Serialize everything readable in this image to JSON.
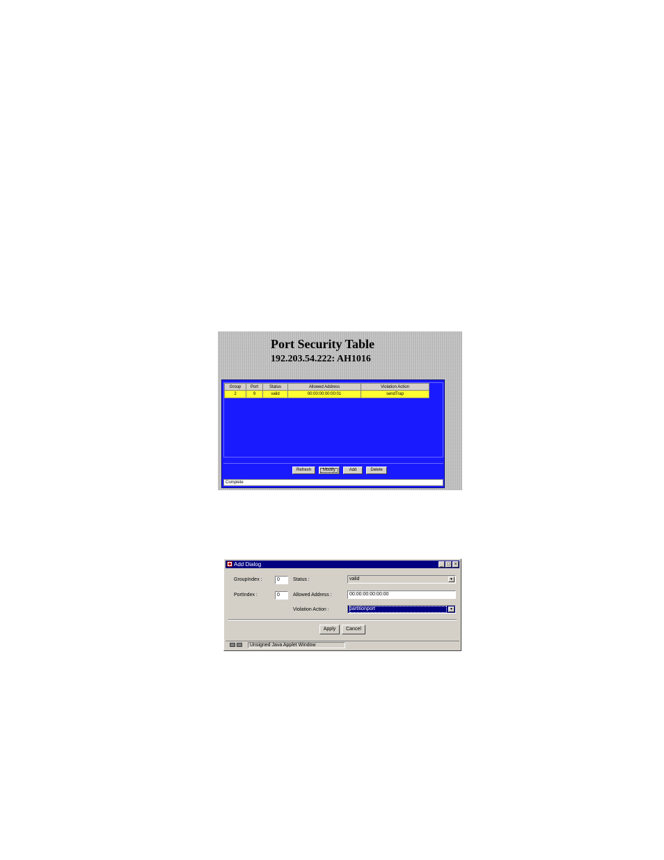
{
  "port_security": {
    "title": "Port Security Table",
    "subtitle": "192.203.54.222: AH1016",
    "columns": [
      "Group",
      "Port",
      "Status",
      "Allowed Address",
      "Violation Action"
    ],
    "rows": [
      [
        "2",
        "9",
        "valid",
        "00:00:00:00:00:01",
        "sendTrap"
      ]
    ],
    "buttons": {
      "refresh": "Refresh",
      "modify": "Modify",
      "add": "Add",
      "delete": "Delete"
    },
    "status_text": "Complete",
    "colors": {
      "panel": "#1a1aff",
      "row_highlight": "#ffff33"
    }
  },
  "add_dialog": {
    "title": "Add Dialog",
    "window_buttons": {
      "minimize": "_",
      "maximize": "□",
      "close": "×"
    },
    "group_index_label": "GroupIndex :",
    "group_index_value": "0",
    "port_index_label": "PortIndex :",
    "port_index_value": "0",
    "status_label": "Status :",
    "status_value": "valid",
    "allowed_address_label": "Allowed Address :",
    "allowed_address_value": "00:00:00:00:00:00",
    "violation_action_label": "Violation Action :",
    "violation_action_value": "partitionport",
    "apply_label": "Apply",
    "cancel_label": "Cancel",
    "footer_text": "Unsigned Java Applet Window",
    "icons": [
      "java-cup-icon",
      "key-icon",
      "dropdown-arrow-icon"
    ]
  }
}
